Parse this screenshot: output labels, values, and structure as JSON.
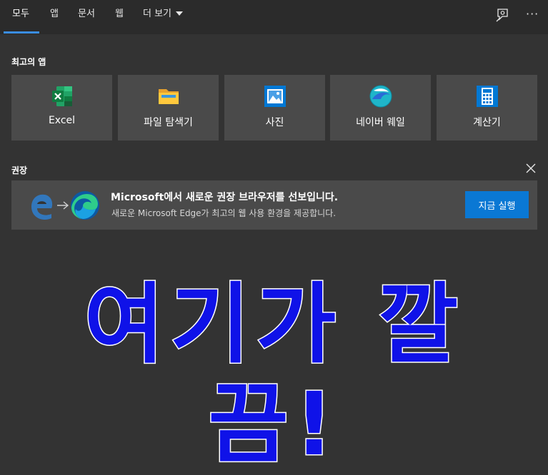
{
  "nav": {
    "tabs": [
      "모두",
      "앱",
      "문서",
      "웹"
    ],
    "more_label": "더 보기",
    "active_tab": "모두",
    "more_options_glyph": "···",
    "feedback_icon": "feedback-icon"
  },
  "top_apps": {
    "title": "최고의 앱",
    "items": [
      {
        "label": "Excel",
        "icon": "excel-icon"
      },
      {
        "label": "파일 탐색기",
        "icon": "folder-icon"
      },
      {
        "label": "사진",
        "icon": "photos-icon"
      },
      {
        "label": "네이버 웨일",
        "icon": "whale-browser-icon"
      },
      {
        "label": "계산기",
        "icon": "calculator-icon"
      }
    ]
  },
  "recommended": {
    "title": "권장",
    "card_title": "Microsoft에서 새로운 권장 브라우저를 선보입니다.",
    "card_subtitle": "새로운 Microsoft Edge가 최고의 웹 사용 환경을 제공합니다.",
    "button_label": "지금 실행"
  },
  "overlay": {
    "text": "여기가 깔끔!",
    "fill_color": "#0f12e8"
  },
  "colors": {
    "accent": "#0a78d4",
    "tab_underline": "#3a8de0",
    "background": "#333333",
    "tile": "#4a4a4a"
  }
}
